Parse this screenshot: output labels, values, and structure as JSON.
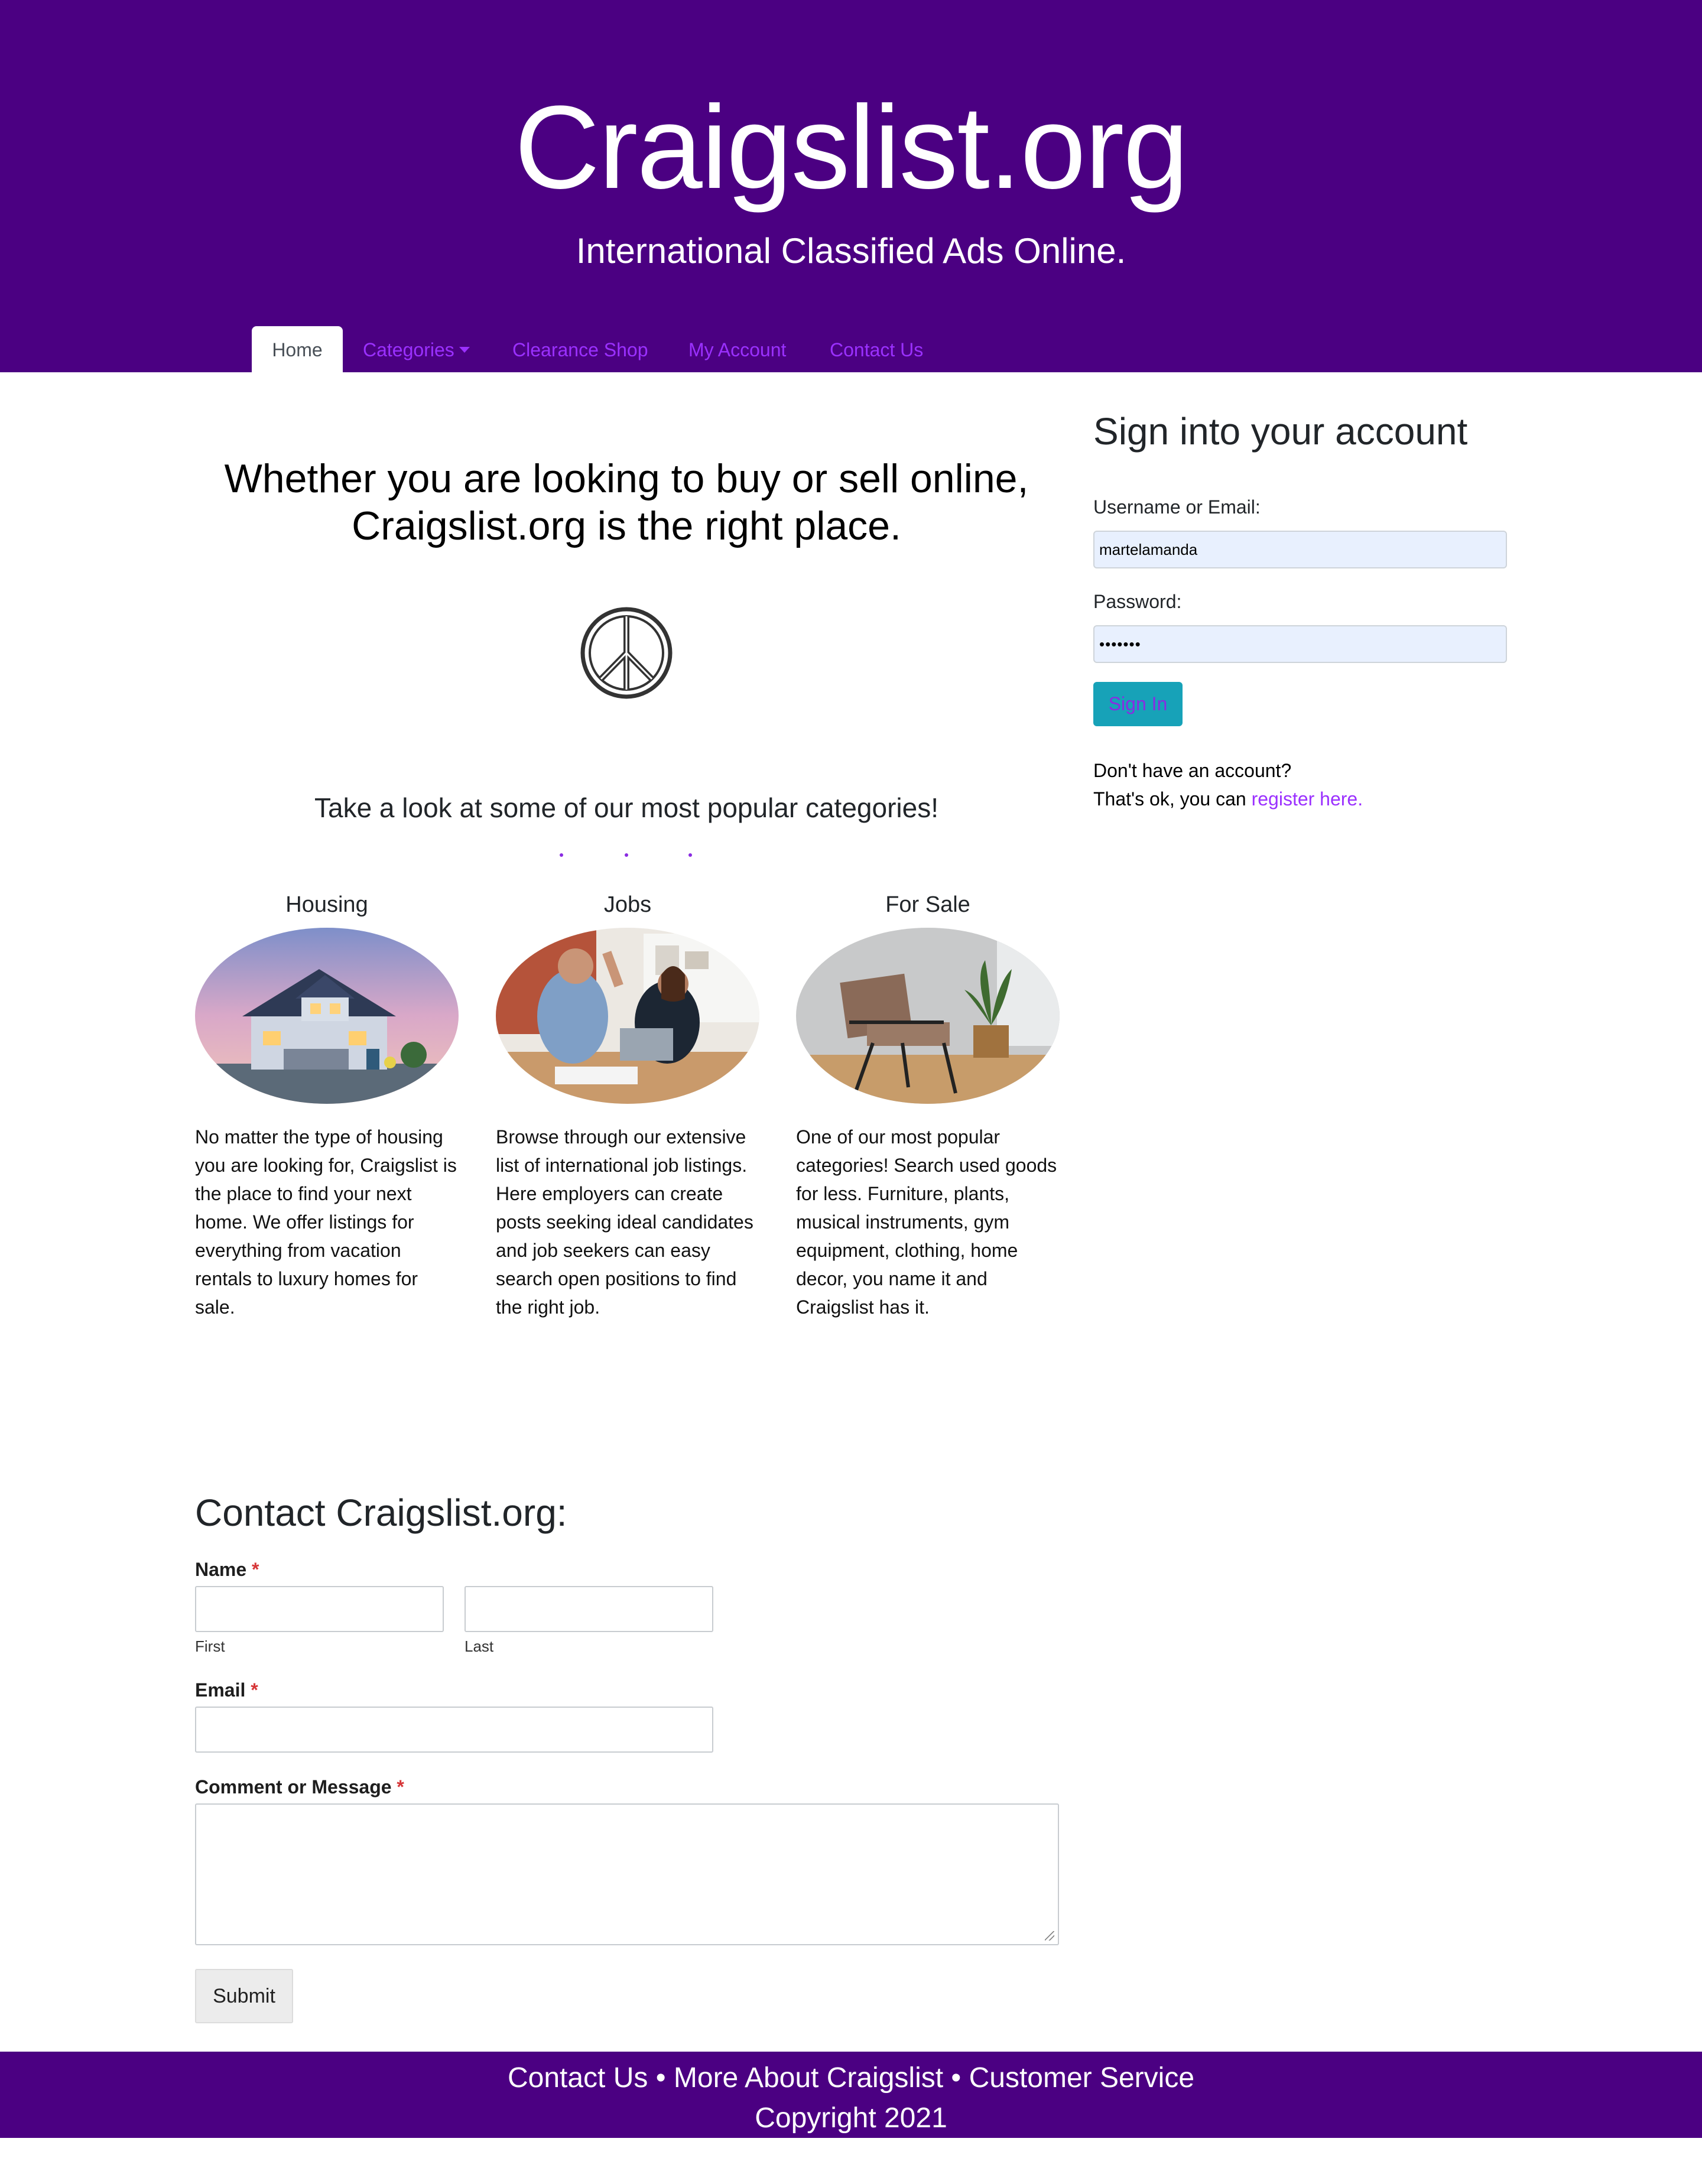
{
  "header": {
    "title": "Craigslist.org",
    "tagline": "International Classified Ads Online."
  },
  "nav": {
    "items": [
      {
        "label": "Home",
        "active": true
      },
      {
        "label": "Categories",
        "dropdown": true
      },
      {
        "label": "Clearance Shop"
      },
      {
        "label": "My Account"
      },
      {
        "label": "Contact Us"
      }
    ]
  },
  "hero": {
    "line1": "Whether you are looking to buy or sell online,",
    "line2": "Craigslist.org is the right place.",
    "icon": "peace-sign-icon"
  },
  "popular": {
    "heading": "Take a look at some of our most popular categories!",
    "categories": [
      {
        "title": "Housing",
        "image": "house-photo",
        "text": "No matter the type of housing you are looking for, Craigslist is the place to find your next home. We offer listings for everything from vacation rentals to luxury homes for sale."
      },
      {
        "title": "Jobs",
        "image": "office-high-five-photo",
        "text": "Browse through our extensive list of international job listings. Here employers can create posts seeking ideal candidates and job seekers can easy search open positions to find the right job."
      },
      {
        "title": "For Sale",
        "image": "chair-and-plant-photo",
        "text": "One of our most popular categories! Search used goods for less. Furniture, plants, musical instruments, gym equipment, clothing, home decor, you name it and Craigslist has it."
      }
    ]
  },
  "contact_form": {
    "title": "Contact Craigslist.org:",
    "name_label": "Name",
    "required_mark": "*",
    "first_label": "First",
    "last_label": "Last",
    "email_label": "Email",
    "message_label": "Comment or Message",
    "submit_label": "Submit"
  },
  "signin": {
    "title": "Sign into your account",
    "username_label": "Username or Email:",
    "username_value": "martelamanda",
    "password_label": "Password:",
    "password_value": "•••••••",
    "button_label": "Sign In",
    "no_account": "Don't have an account?",
    "register_prefix": "That's ok, you can ",
    "register_link": "register here."
  },
  "footer": {
    "link1": "Contact Us",
    "link2": "More About Craigslist",
    "link3": "Customer Service",
    "separator": "•",
    "copyright": "Copyright 2021"
  },
  "colors": {
    "brand_purple": "#4b0082",
    "link_purple": "#9b30ff",
    "signin_button": "#17a2b8",
    "autofill_input": "#e8f0fe"
  }
}
